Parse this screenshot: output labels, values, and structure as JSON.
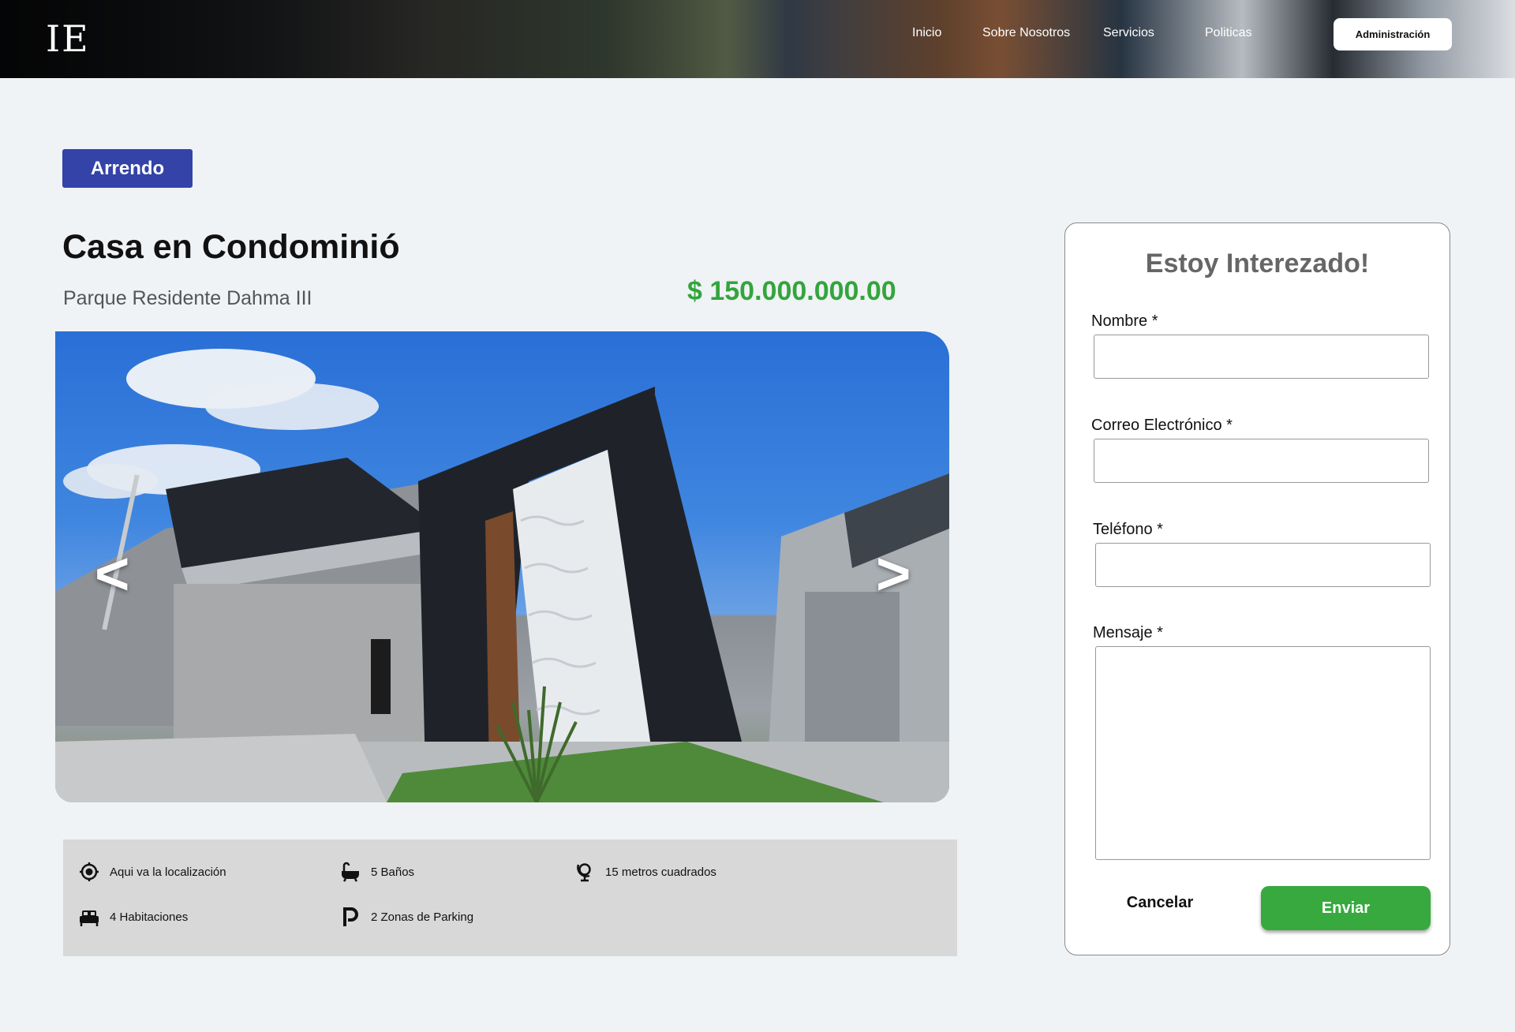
{
  "header": {
    "logo": "IE",
    "nav": [
      "Inicio",
      "Sobre Nosotros",
      "Servicios",
      "Politicas"
    ],
    "admin_label": "Administración"
  },
  "listing": {
    "badge": "Arrendo",
    "title": "Casa en Condominió",
    "location": "Parque Residente Dahma III",
    "price": "$ 150.000.000.00",
    "prev_arrow": "<",
    "next_arrow": ">",
    "features": [
      {
        "icon": "location-target-icon",
        "text": "Aqui va la localización"
      },
      {
        "icon": "bathtub-icon",
        "text": "5 Baños"
      },
      {
        "icon": "globe-stand-icon",
        "text": "15 metros cuadrados"
      },
      {
        "icon": "bed-icon",
        "text": "4 Habitaciones"
      },
      {
        "icon": "parking-icon",
        "text": "2 Zonas de Parking"
      }
    ]
  },
  "form": {
    "title": "Estoy Interezado!",
    "name_label": "Nombre *",
    "email_label": "Correo Electrónico *",
    "phone_label": "Teléfono *",
    "message_label": "Mensaje *",
    "name_value": "",
    "email_value": "",
    "phone_value": "",
    "message_value": "",
    "cancel_label": "Cancelar",
    "send_label": "Enviar"
  },
  "colors": {
    "badge": "#3343a8",
    "price": "#34a43c",
    "send_button": "#37a93f",
    "page_background": "#eff3f5",
    "features_background": "#d8d8d8"
  }
}
